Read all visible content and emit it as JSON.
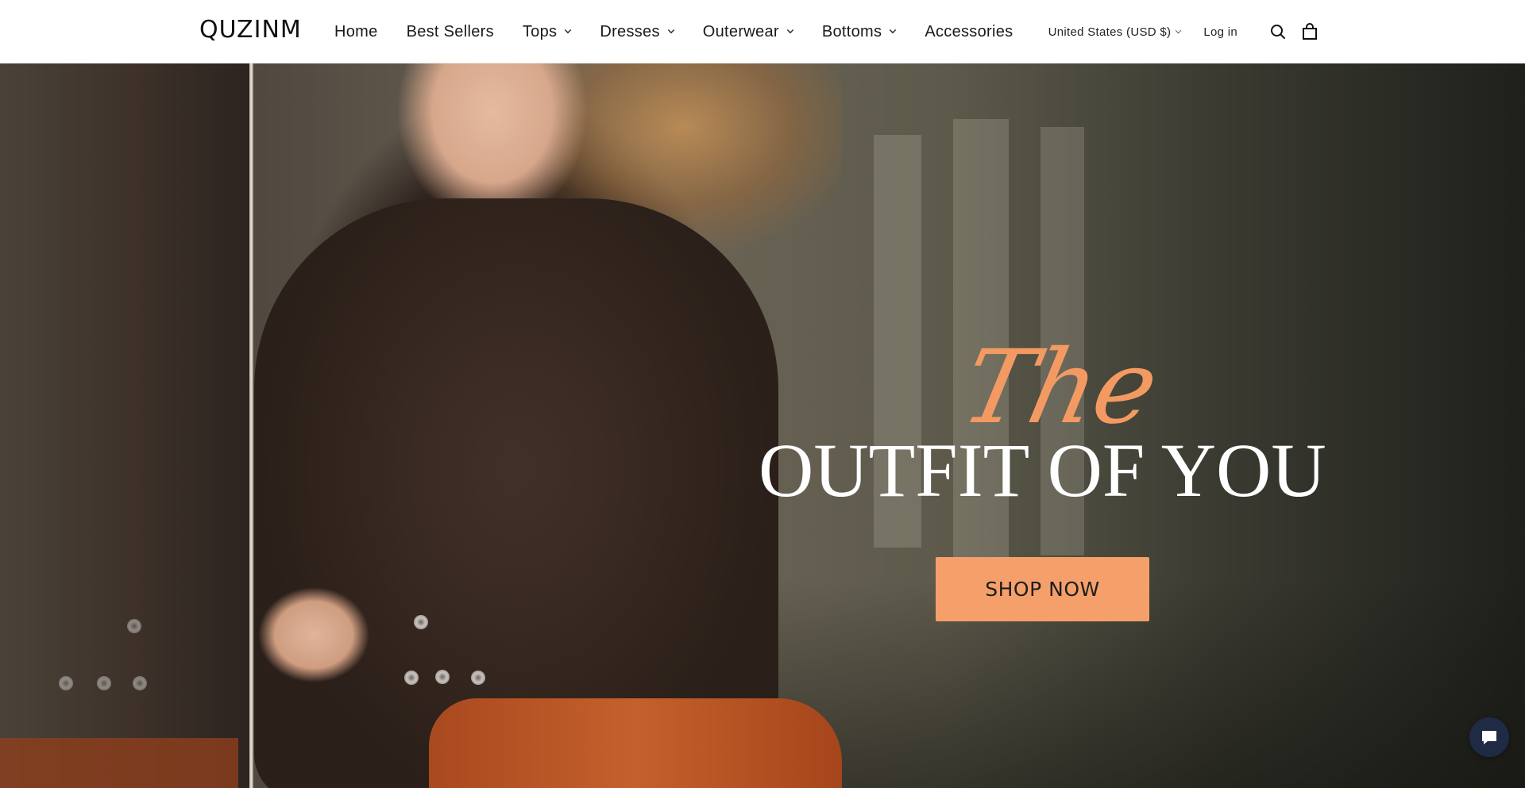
{
  "brand": {
    "logo_text": "QUZINM"
  },
  "nav": {
    "items": [
      {
        "label": "Home",
        "has_dropdown": false
      },
      {
        "label": "Best Sellers",
        "has_dropdown": false
      },
      {
        "label": "Tops",
        "has_dropdown": true
      },
      {
        "label": "Dresses",
        "has_dropdown": true
      },
      {
        "label": "Outerwear",
        "has_dropdown": true
      },
      {
        "label": "Bottoms",
        "has_dropdown": true
      },
      {
        "label": "Accessories",
        "has_dropdown": false
      }
    ]
  },
  "header_tools": {
    "currency_label": "United States (USD $)",
    "login_label": "Log in",
    "search_icon": "search-icon",
    "cart_icon": "shopping-bag-icon"
  },
  "hero": {
    "script_text": "The",
    "title": "OUTFIT OF YOU",
    "cta_label": "SHOP NOW",
    "accent_color": "#f39a62",
    "cta_color": "#f5a06a"
  },
  "chat": {
    "icon": "chat-bubble-icon",
    "bg_color": "#1f2a44"
  }
}
